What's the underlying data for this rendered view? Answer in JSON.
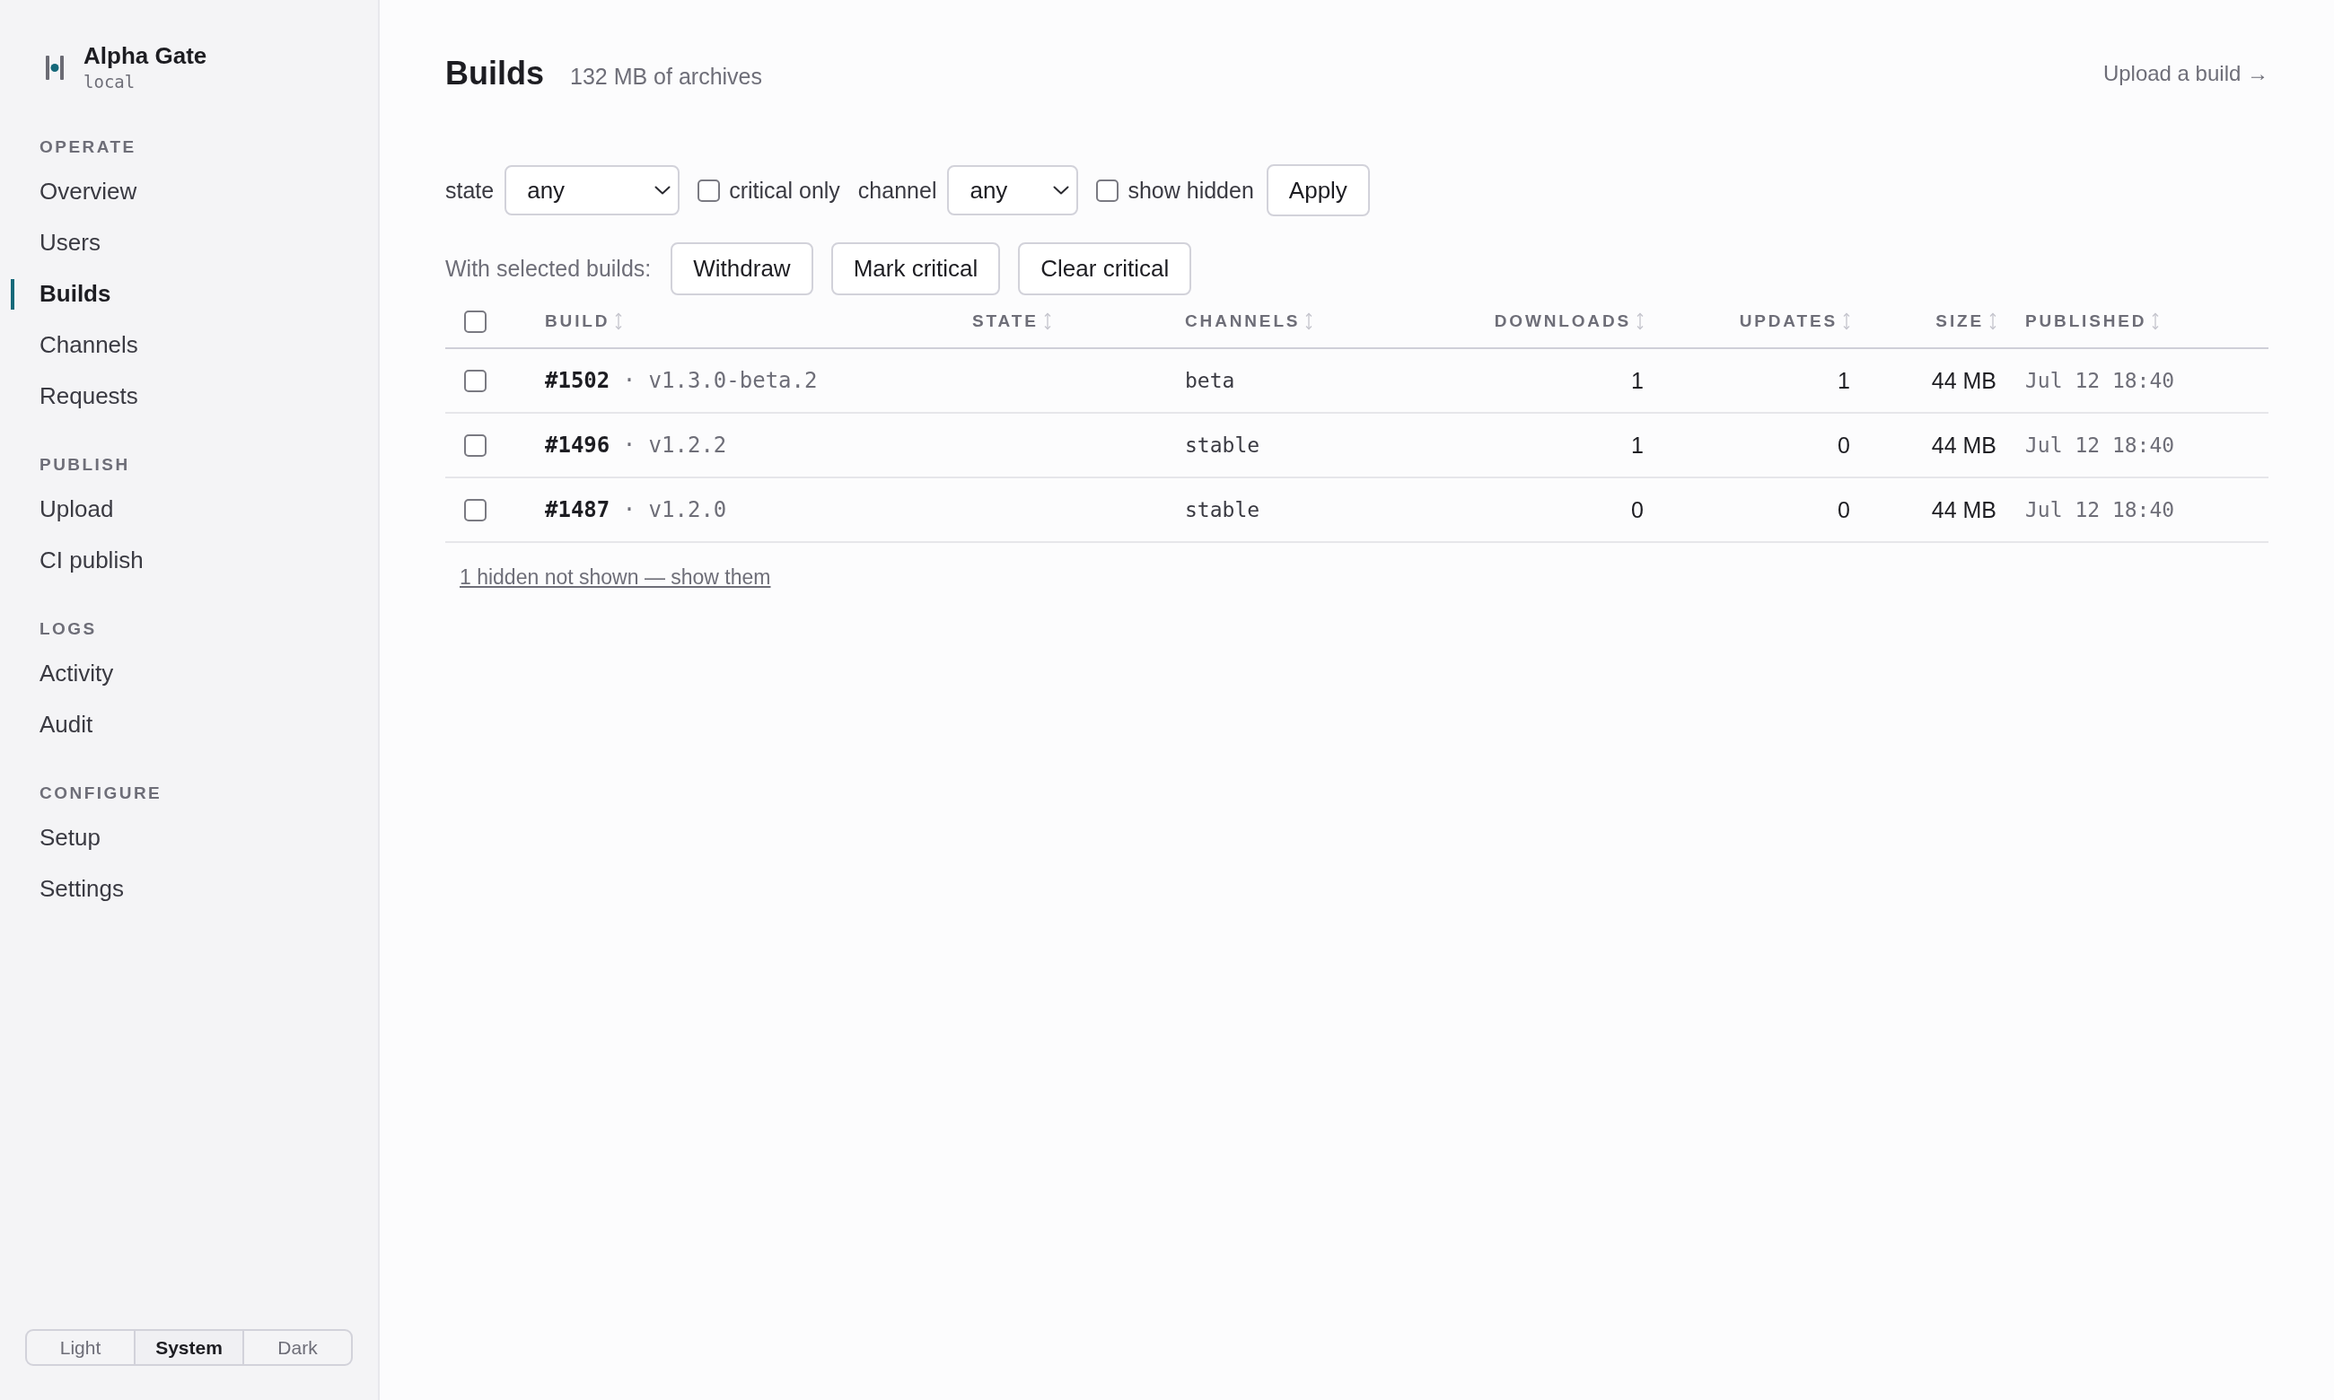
{
  "sidebar": {
    "brand": {
      "name": "Alpha Gate",
      "subtitle": "local"
    },
    "sections": [
      {
        "heading": "OPERATE",
        "items": [
          {
            "label": "Overview",
            "selected": false
          },
          {
            "label": "Users",
            "selected": false
          },
          {
            "label": "Builds",
            "selected": true
          },
          {
            "label": "Channels",
            "selected": false
          },
          {
            "label": "Requests",
            "selected": false
          }
        ]
      },
      {
        "heading": "PUBLISH",
        "items": [
          {
            "label": "Upload",
            "selected": false
          },
          {
            "label": "CI publish",
            "selected": false
          }
        ]
      },
      {
        "heading": "LOGS",
        "items": [
          {
            "label": "Activity",
            "selected": false
          },
          {
            "label": "Audit",
            "selected": false
          }
        ]
      },
      {
        "heading": "CONFIGURE",
        "items": [
          {
            "label": "Setup",
            "selected": false
          },
          {
            "label": "Settings",
            "selected": false
          }
        ]
      }
    ],
    "theme_switch": [
      {
        "label": "Light",
        "selected": false
      },
      {
        "label": "System",
        "selected": true
      },
      {
        "label": "Dark",
        "selected": false
      }
    ]
  },
  "header": {
    "title": "Builds",
    "subtitle": "132 MB of archives",
    "link": "Upload a build →"
  },
  "filters": [
    {
      "kind": "select",
      "label": "state",
      "value": "any"
    },
    {
      "kind": "checkbox",
      "label": "critical only",
      "checked": false
    },
    {
      "kind": "select",
      "label": "channel",
      "value": "any"
    },
    {
      "kind": "checkbox",
      "label": "show hidden",
      "checked": false
    },
    {
      "kind": "button",
      "label": "Apply"
    }
  ],
  "bulk_actions": {
    "label": "With selected builds:",
    "buttons": [
      "Withdraw",
      "Mark critical",
      "Clear critical"
    ]
  },
  "table": {
    "header_checkbox": {
      "checked": false
    },
    "columns": [
      {
        "label": "BUILD",
        "kind": "text"
      },
      {
        "label": "STATE",
        "kind": "text"
      },
      {
        "label": "CHANNELS",
        "kind": "text"
      },
      {
        "label": "DOWNLOADS",
        "kind": "number"
      },
      {
        "label": "UPDATES",
        "kind": "number"
      },
      {
        "label": "SIZE",
        "kind": "number"
      },
      {
        "label": "PUBLISHED",
        "kind": "text"
      }
    ],
    "rows": [
      {
        "checked": false,
        "build": "**#1502** · v1.3.0-beta.2",
        "channels": "beta",
        "downloads": "1",
        "updates": "1",
        "size": "44 MB",
        "published": "Jul 12 18:40"
      },
      {
        "checked": false,
        "build": "**#1496** · v1.2.2",
        "channels": "stable",
        "downloads": "1",
        "updates": "0",
        "size": "44 MB",
        "published": "Jul 12 18:40"
      },
      {
        "checked": false,
        "build": "**#1487** · v1.2.0",
        "channels": "stable",
        "downloads": "0",
        "updates": "0",
        "size": "44 MB",
        "published": "Jul 12 18:40"
      }
    ],
    "hidden_note": "1 hidden not shown — show them"
  }
}
